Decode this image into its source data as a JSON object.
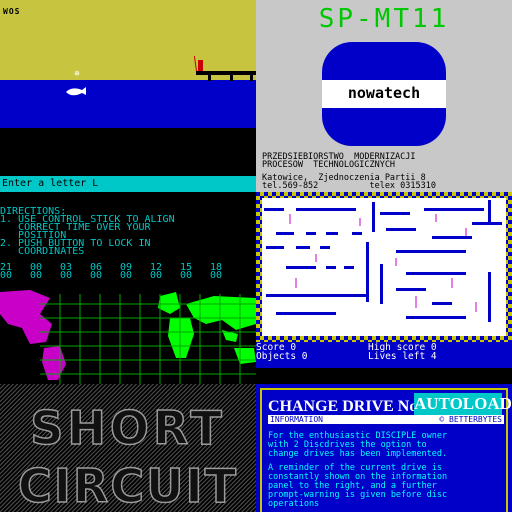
{
  "panel1": {
    "word_label": "WOS"
  },
  "panel2": {
    "title": "SP-MT11",
    "logo_text": "nowatech",
    "org_line1": "PRZEDSIEBIORSTWO  MODERNIZACJI",
    "org_line2": "PROCESOW  TECHNOLOGICZNYCH",
    "address_line": "Katowice,  Zjednoczenia Partii 8",
    "phone_line": "tel.569-852          telex 0315310"
  },
  "panel3": {
    "prompt": "Enter a letter L",
    "directions_title": "DIRECTIONS:",
    "directions_lines": [
      "1. USE CONTROL STICK TO ALIGN",
      "   CORRECT TIME OVER YOUR",
      "   POSITION",
      "2. PUSH BUTTON TO LOCK IN",
      "   COORDINATES"
    ],
    "hours_top": [
      "21",
      "00",
      "03",
      "06",
      "09",
      "12",
      "15",
      "18"
    ],
    "hours_bottom": [
      "00",
      "00",
      "00",
      "00",
      "00",
      "00",
      "00",
      "00"
    ]
  },
  "panel4": {
    "score_label": "Score 0",
    "objects_label": "Objects 0",
    "high_score_label": "High score 0",
    "lives_label": "Lives left 4"
  },
  "panel5": {
    "title_line1": "SHORT",
    "title_line2": "CIRCUIT"
  },
  "panel6": {
    "heading": "CHANGE DRIVE No.",
    "badge": "AUTOLOADER",
    "info_left": "INFORMATION",
    "info_right": "© BETTERBYTES",
    "para1": [
      "For the enthusiastic DISCIPLE owner",
      "with 2 Discdrives the option to",
      "change drives has been implemented."
    ],
    "para2": [
      "A reminder of the current drive is",
      "constantly shown on the information",
      "panel to the right, and a further",
      "prompt-warning is given before disc",
      "operations"
    ]
  },
  "colors": {
    "spectrum_blue": "#0000c8",
    "spectrum_cyan": "#00c8c8",
    "spectrum_yellow": "#c7c43f",
    "spectrum_green": "#00c800",
    "spectrum_magenta": "#c800c8"
  }
}
